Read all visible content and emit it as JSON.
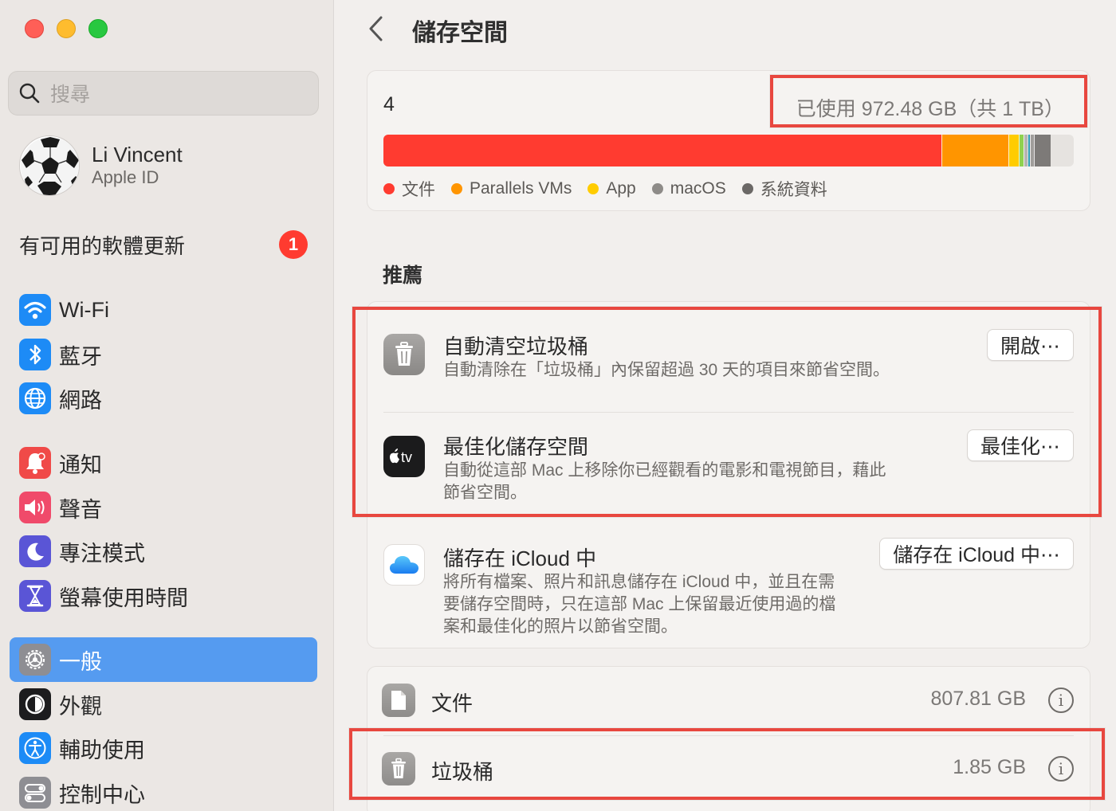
{
  "window": {
    "title": "儲存空間"
  },
  "sidebar": {
    "search_placeholder": "搜尋",
    "profile": {
      "name": "Li Vincent",
      "subtitle": "Apple ID"
    },
    "update": {
      "label": "有可用的軟體更新",
      "count": "1"
    },
    "items": [
      {
        "label": "Wi-Fi",
        "icon": "wifi-icon",
        "color": "#1d8bf6"
      },
      {
        "label": "藍牙",
        "icon": "bluetooth-icon",
        "color": "#1d8bf6"
      },
      {
        "label": "網路",
        "icon": "globe-icon",
        "color": "#1d8bf6"
      },
      {
        "label": "通知",
        "icon": "bell-icon",
        "color": "#f04a48"
      },
      {
        "label": "聲音",
        "icon": "speaker-icon",
        "color": "#f04a6a"
      },
      {
        "label": "專注模式",
        "icon": "moon-icon",
        "color": "#5a55d6"
      },
      {
        "label": "螢幕使用時間",
        "icon": "hourglass-icon",
        "color": "#5a55d6"
      },
      {
        "label": "一般",
        "icon": "gear-icon",
        "color": "#8e8e93",
        "active": true
      },
      {
        "label": "外觀",
        "icon": "appearance-icon",
        "color": "#1c1c1e"
      },
      {
        "label": "輔助使用",
        "icon": "accessibility-icon",
        "color": "#1d8bf6"
      },
      {
        "label": "控制中心",
        "icon": "control-center-icon",
        "color": "#8e8e93"
      }
    ]
  },
  "storage": {
    "volume_name": "4",
    "used_text": "已使用 972.48 GB（共 1 TB）",
    "segments": [
      {
        "name": "文件",
        "fraction": 0.808,
        "color": "#ff3b30"
      },
      {
        "name": "Parallels VMs",
        "fraction": 0.097,
        "color": "#ff9500"
      },
      {
        "name": "App",
        "fraction": 0.015,
        "color": "#ffcc00"
      },
      {
        "name": "other-green",
        "fraction": 0.007,
        "color": "#8fd14f"
      },
      {
        "name": "other-1",
        "fraction": 0.006,
        "color": "#b7b4b1"
      },
      {
        "name": "other-2",
        "fraction": 0.004,
        "color": "#2f9db4"
      },
      {
        "name": "macOS",
        "fraction": 0.005,
        "color": "#a09d9a"
      },
      {
        "name": "系統資料",
        "fraction": 0.024,
        "color": "#7d7a78"
      }
    ],
    "legend": [
      {
        "label": "文件",
        "color": "#ff3b30"
      },
      {
        "label": "Parallels VMs",
        "color": "#ff9500"
      },
      {
        "label": "App",
        "color": "#ffcc00"
      },
      {
        "label": "macOS",
        "color": "#8e8b88"
      },
      {
        "label": "系統資料",
        "color": "#6b6866"
      }
    ]
  },
  "recommendations": {
    "title": "推薦",
    "items": [
      {
        "title": "自動清空垃圾桶",
        "desc": [
          "自動清除在「垃圾桶」內保留超過 30 天的項目來節省空間。"
        ],
        "button": "開啟⋯",
        "icon": "trash-icon"
      },
      {
        "title": "最佳化儲存空間",
        "desc": [
          "自動從這部 Mac 上移除你已經觀看的電影和電視節目，藉此",
          "節省空間。"
        ],
        "button": "最佳化⋯",
        "icon": "apple-tv-icon",
        "icon_text": "tv"
      },
      {
        "title": "儲存在 iCloud 中",
        "desc": [
          "將所有檔案、照片和訊息儲存在 iCloud 中，並且在需",
          "要儲存空間時，只在這部 Mac 上保留最近使用過的檔",
          "案和最佳化的照片以節省空間。"
        ],
        "button": "儲存在 iCloud 中⋯",
        "icon": "icloud-icon"
      }
    ]
  },
  "categories": [
    {
      "label": "文件",
      "size": "807.81 GB",
      "icon": "document-icon"
    },
    {
      "label": "垃圾桶",
      "size": "1.85 GB",
      "icon": "trash-icon"
    }
  ],
  "info_glyph": "i"
}
